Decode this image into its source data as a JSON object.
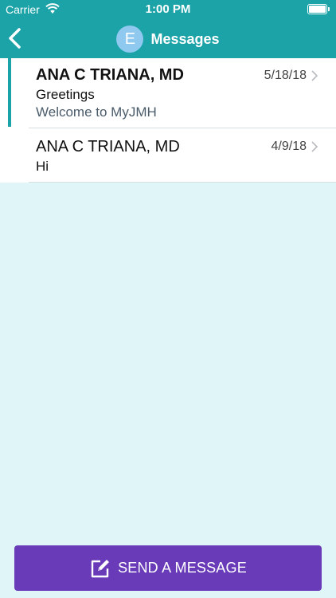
{
  "status_bar": {
    "carrier": "Carrier",
    "time": "1:00 PM"
  },
  "nav": {
    "avatar_letter": "E",
    "title": "Messages"
  },
  "messages": [
    {
      "sender": "ANA C TRIANA, MD",
      "date": "5/18/18",
      "subject": "Greetings",
      "preview": "Welcome to MyJMH",
      "unread": true
    },
    {
      "sender": "ANA C TRIANA, MD",
      "date": "4/9/18",
      "subject": "Hi",
      "unread": false
    }
  ],
  "footer": {
    "send_label": "SEND A MESSAGE"
  },
  "colors": {
    "nav_bar": "#1ba3a8",
    "background": "#dff5f8",
    "send_button": "#6a3bb8",
    "avatar": "#8fc9ef"
  }
}
